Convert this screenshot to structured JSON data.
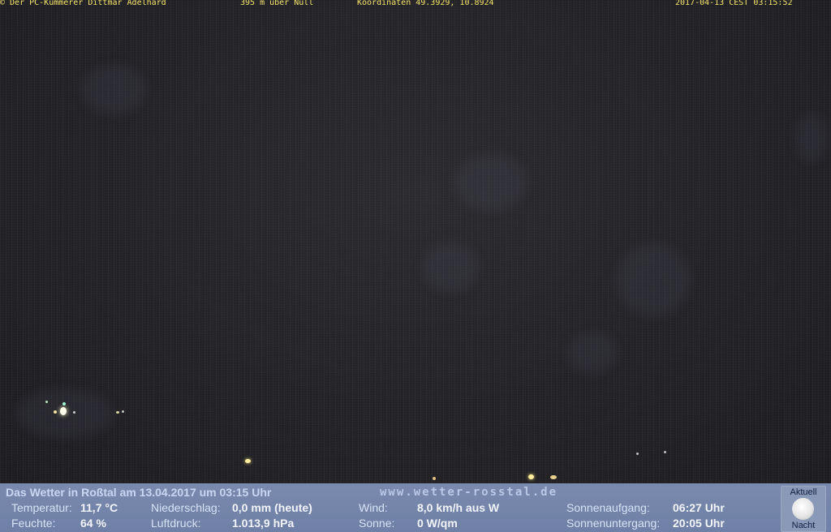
{
  "overlay": {
    "copyright": "© Der PC-Kümmerer Dittmar Adelhard",
    "altitude": "395 m über Null",
    "coordinates": "Koordinaten 49.3929, 10.8924",
    "timestamp": "2017-04-13 CEST 03:15:52"
  },
  "panel": {
    "title": "Das Wetter in Roßtal am 13.04.2017 um 03:15 Uhr",
    "website": "www.wetter-rosstal.de",
    "temperatur_label": "Temperatur:",
    "temperatur_value": "11,7 °C",
    "feuchte_label": "Feuchte:",
    "feuchte_value": "64 %",
    "niederschlag_label": "Niederschlag:",
    "niederschlag_value": "0,0 mm (heute)",
    "luftdruck_label": "Luftdruck:",
    "luftdruck_value": "1.013,9 hPa",
    "wind_label": "Wind:",
    "wind_value": "8,0 km/h aus W",
    "sonne_label": "Sonne:",
    "sonne_value": "0 W/qm",
    "sonnenaufgang_label": "Sonnenaufgang:",
    "sonnenaufgang_value": "06:27 Uhr",
    "sonnenuntergang_label": "Sonnenuntergang:",
    "sonnenuntergang_value": "20:05 Uhr",
    "status_top": "Aktuell",
    "status_bottom": "Nacht"
  },
  "colors": {
    "overlay_text": "#f3e46a",
    "panel_bg": "#7a8aae"
  }
}
